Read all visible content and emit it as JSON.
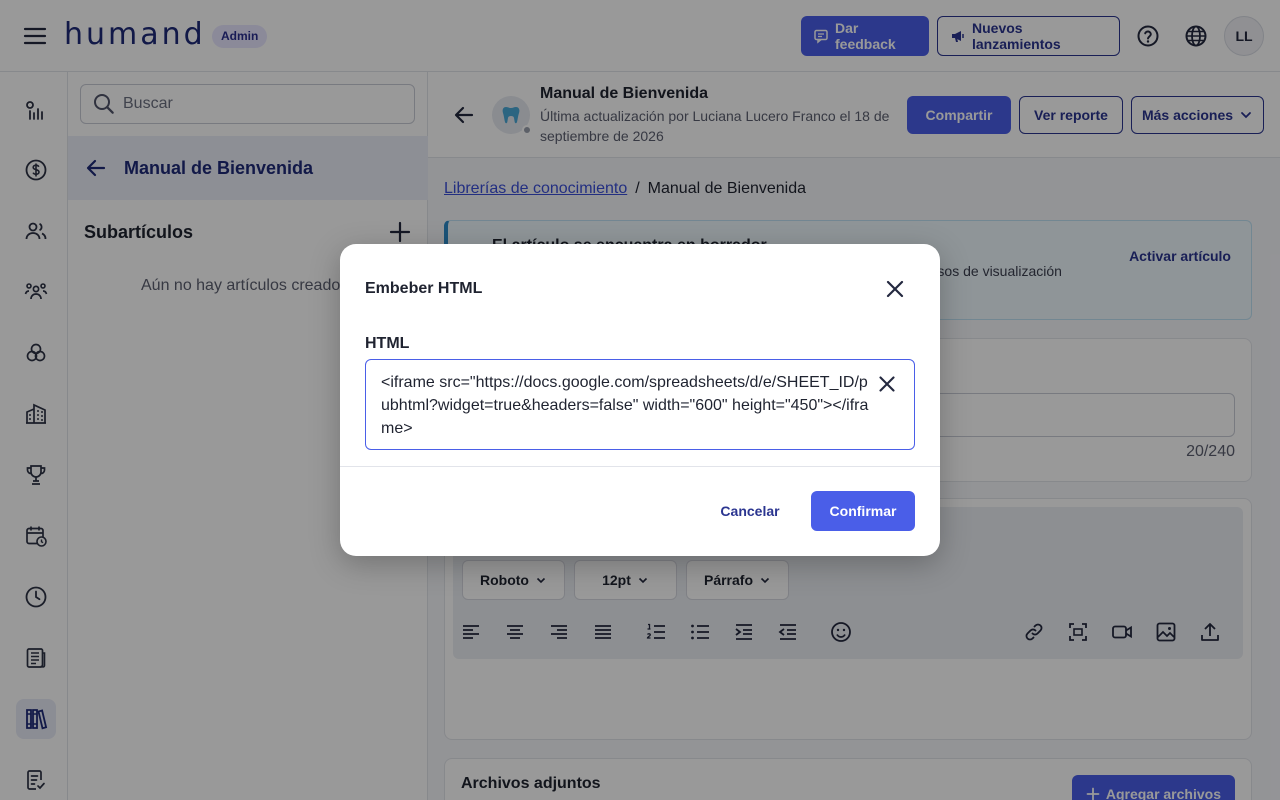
{
  "header": {
    "logo": "humand",
    "admin_badge": "Admin",
    "feedback_label": "Dar feedback",
    "launches_label": "Nuevos lanzamientos",
    "avatar_initials": "LL"
  },
  "rail": {
    "icons": [
      "analytics-icon",
      "dollar-icon",
      "users-icon",
      "groups-icon",
      "circles-icon",
      "building-icon",
      "trophy-icon",
      "calendar-clock-icon",
      "clock-icon",
      "newspaper-icon",
      "library-icon",
      "checklist-icon"
    ],
    "active": "library-icon"
  },
  "sidebar": {
    "search_placeholder": "Buscar",
    "title": "Manual de Bienvenida",
    "subarticles_title": "Subartículos",
    "empty_text": "Aún no hay artículos creados"
  },
  "article": {
    "title": "Manual de Bienvenida",
    "subtitle": "Última actualización por Luciana Lucero Franco el 18 de septiembre de 2026",
    "share_label": "Compartir",
    "report_label": "Ver reporte",
    "more_label": "Más acciones",
    "breadcrumb_link": "Librerías de conocimiento",
    "breadcrumb_sep": "/",
    "breadcrumb_current": "Manual de Bienvenida",
    "draft_title": "El artículo se encuentra en borrador",
    "draft_text": "rmisos de visualización",
    "activate_label": "Activar artículo",
    "counter": "20/240"
  },
  "editor": {
    "font": "Roboto",
    "size": "12pt",
    "block": "Párrafo",
    "format_icons": [
      "align-left-icon",
      "align-center-icon",
      "align-right-icon",
      "align-justify-icon",
      "ordered-list-icon",
      "bullet-list-icon",
      "indent-icon",
      "outdent-icon",
      "emoji-icon",
      "link-icon",
      "embed-icon",
      "video-icon",
      "image-icon",
      "upload-icon"
    ]
  },
  "attachments": {
    "title": "Archivos adjuntos",
    "add_label": "Agregar archivos"
  },
  "modal": {
    "title": "Embeber HTML",
    "field_label": "HTML",
    "value": "<iframe src=\"https://docs.google.com/spreadsheets/d/e/SHEET_ID/pubhtml?widget=true&headers=false\" width=\"600\" height=\"450\"></iframe>",
    "cancel_label": "Cancelar",
    "confirm_label": "Confirmar"
  },
  "colors": {
    "primary": "#4a5ee8",
    "brand": "#1e2a78",
    "overlay": "rgba(0,0,0,0.4)"
  }
}
